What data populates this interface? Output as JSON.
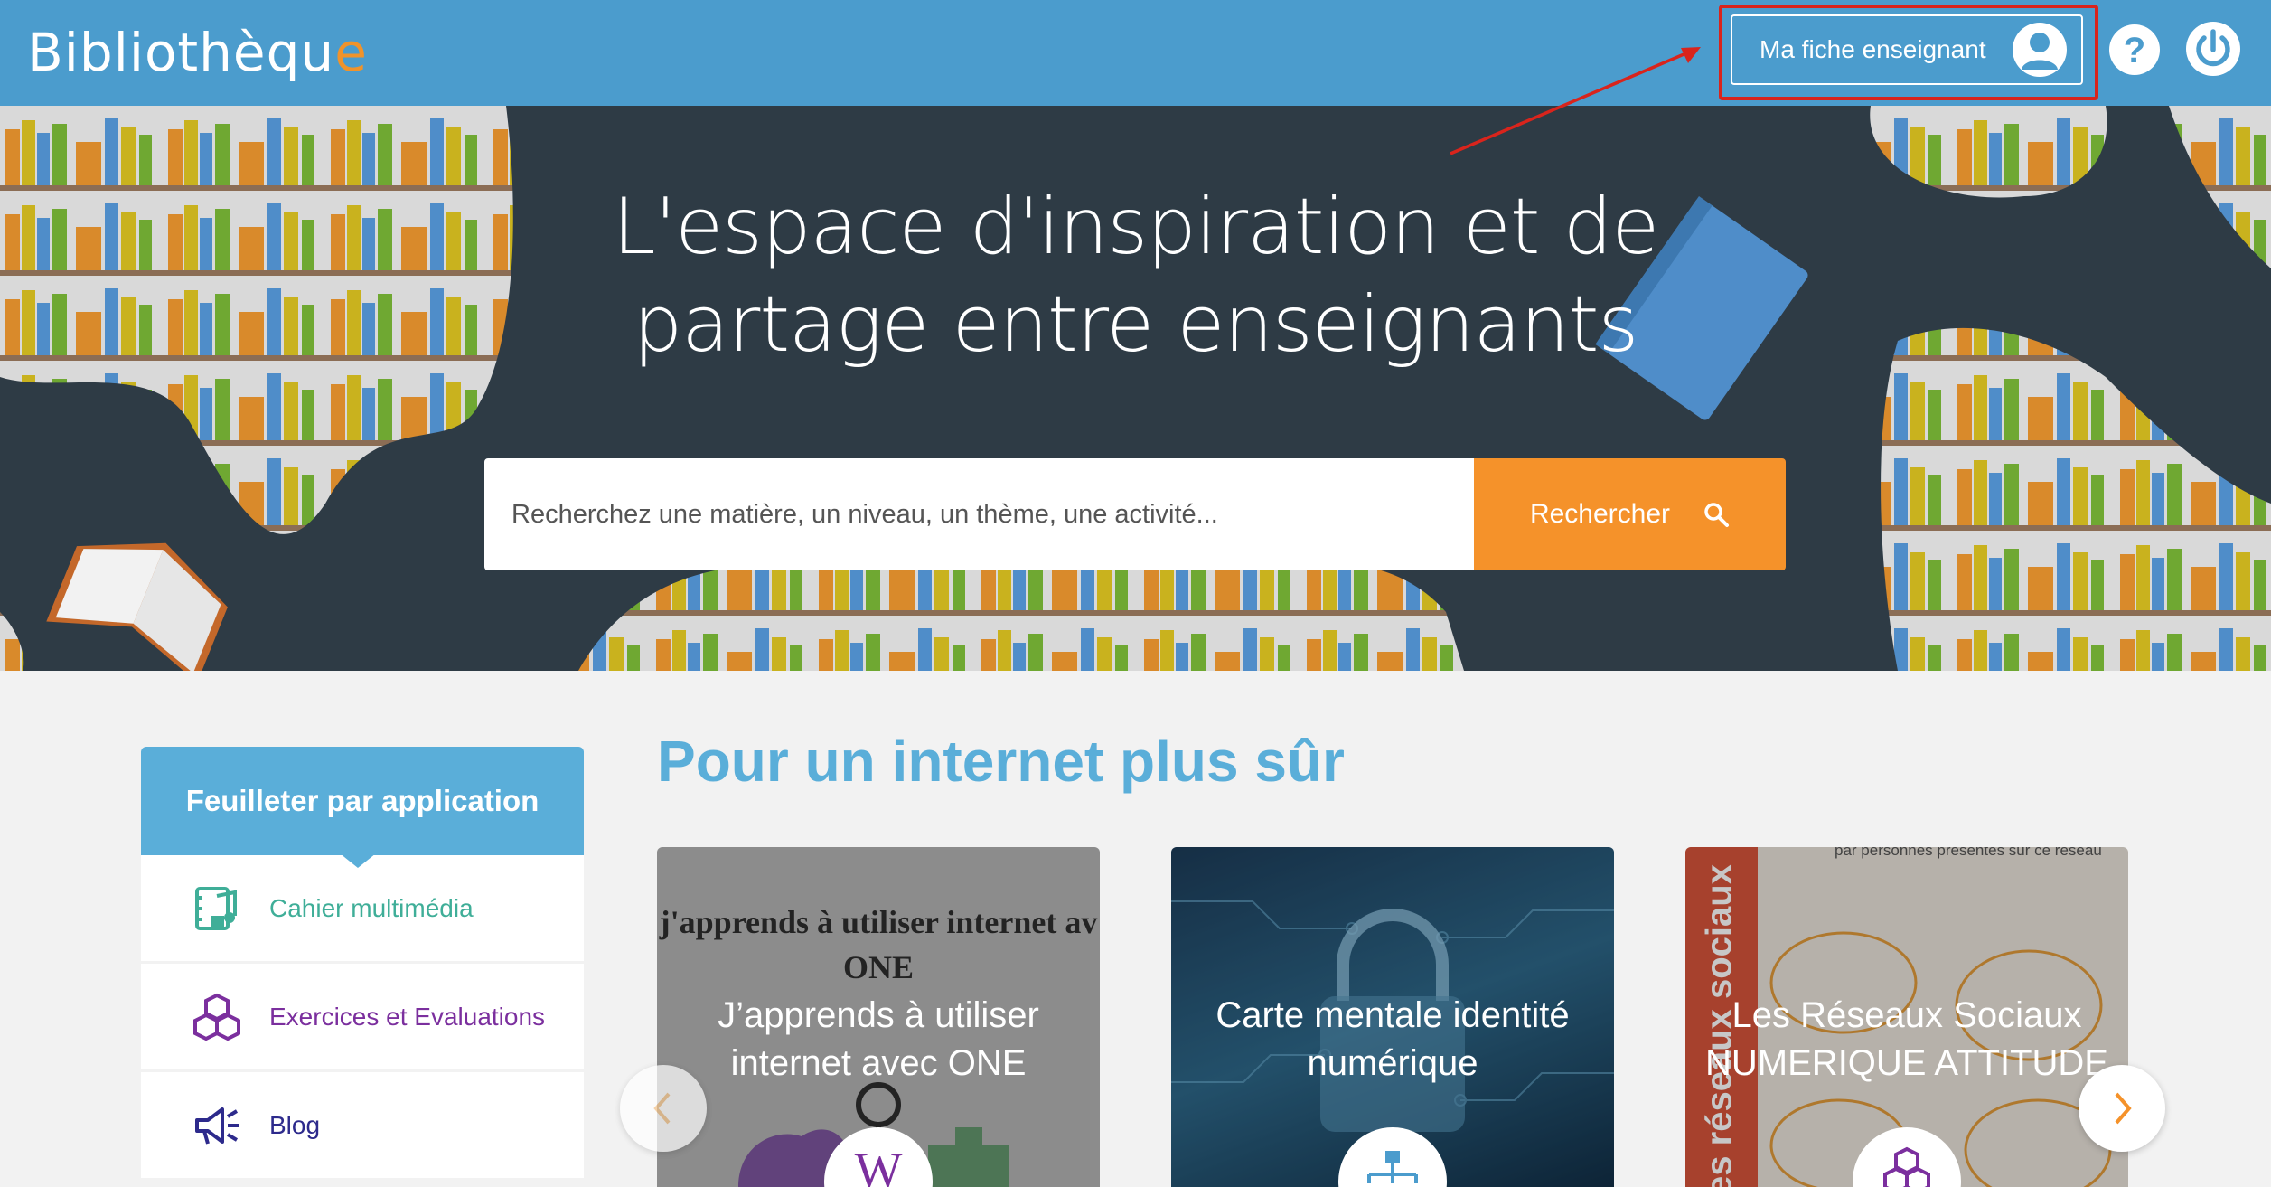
{
  "header": {
    "logo_main": "Bibliothèqu",
    "logo_accent": "e",
    "fiche_label": "Ma fiche enseignant",
    "help_icon": "help-circle-icon",
    "power_icon": "power-icon"
  },
  "hero": {
    "title_line1": "L'espace d'inspiration et de",
    "title_line2": "partage entre enseignants",
    "search_placeholder": "Recherchez une matière, un niveau, un thème, une activité...",
    "search_button": "Rechercher"
  },
  "sidebar": {
    "title": "Feuilleter par application",
    "items": [
      {
        "label": "Cahier multimédia",
        "icon": "multimedia-notebook-icon",
        "color": "#3fae98"
      },
      {
        "label": "Exercices et Evaluations",
        "icon": "cubes-icon",
        "color": "#7b2f9e"
      },
      {
        "label": "Blog",
        "icon": "megaphone-icon",
        "color": "#2d2a8c"
      }
    ]
  },
  "main": {
    "section_title": "Pour un internet plus sûr",
    "cards": [
      {
        "title": "J’apprends à utiliser internet avec ONE",
        "image_text_1": "j'apprends à utiliser internet av",
        "image_text_2": "ONE",
        "badge_icon": "wikipedia-icon"
      },
      {
        "title": "Carte mentale identité numérique",
        "badge_icon": "mindmap-icon"
      },
      {
        "title": "Les Réseaux Sociaux NUMERIQUE ATTITUDE",
        "image_text_1": "es réseaux sociaux",
        "image_text_2": "par personnes présentes sur ce réseau",
        "badge_icon": "cubes-icon"
      }
    ]
  },
  "colors": {
    "header_bg": "#4b9ccd",
    "hero_bg": "#2e3b45",
    "accent_orange": "#f5922a",
    "sidebar_blue": "#5aaed9",
    "annotation_red": "#d9241c"
  }
}
